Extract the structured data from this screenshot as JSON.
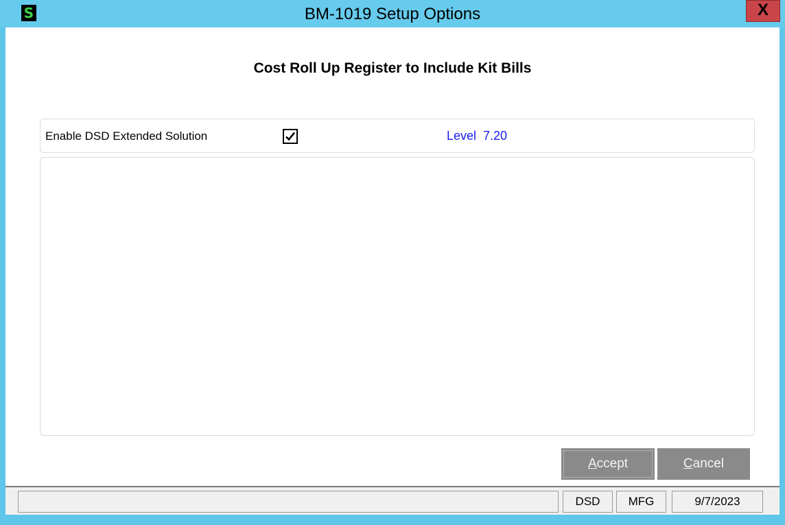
{
  "window": {
    "title": "BM-1019 Setup Options",
    "app_icon_letter": "S",
    "close_glyph": "X",
    "accent_color": "#66cbed",
    "close_color": "#c9454a"
  },
  "dialog": {
    "heading": "Cost Roll Up Register to Include Kit Bills",
    "enable_label": "Enable DSD Extended Solution",
    "enable_checked": true,
    "level_text": "Level  7.20",
    "level_color": "#1a1af0"
  },
  "buttons": {
    "accept_label_prefix": "",
    "accept_label_underlined": "A",
    "accept_label_rest": "ccept",
    "cancel_label_underlined": "C",
    "cancel_label_rest": "ancel"
  },
  "statusbar": {
    "message": "",
    "dsd": "DSD",
    "mfg": "MFG",
    "date": "9/7/2023"
  }
}
